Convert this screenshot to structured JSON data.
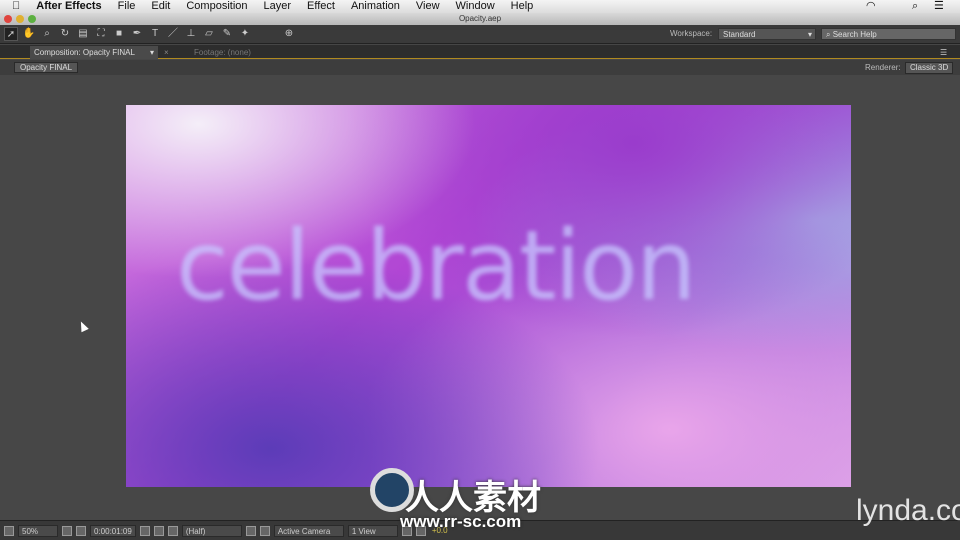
{
  "menubar": {
    "app": "After Effects",
    "items": [
      "File",
      "Edit",
      "Composition",
      "Layer",
      "Effect",
      "Animation",
      "View",
      "Window",
      "Help"
    ]
  },
  "window": {
    "title": "Opacity.aep"
  },
  "toolbar": {
    "workspace_label": "Workspace:",
    "workspace_value": "Standard",
    "search_placeholder": "Search Help"
  },
  "tabs": {
    "composition": "Composition: Opacity FINAL",
    "footage": "Footage: (none)"
  },
  "subbar": {
    "breadcrumb": "Opacity FINAL",
    "renderer_label": "Renderer:",
    "renderer_value": "Classic 3D"
  },
  "composition": {
    "text": "celebration"
  },
  "bottombar": {
    "zoom": "50%",
    "timecode": "0:00:01:09",
    "resolution": "(Half)",
    "camera": "Active Camera",
    "views": "1 View",
    "exposure": "+0.0"
  },
  "watermarks": {
    "site_cn": "人人素材",
    "site_url": "www.rr-sc.com",
    "lynda": "lynda.com"
  }
}
